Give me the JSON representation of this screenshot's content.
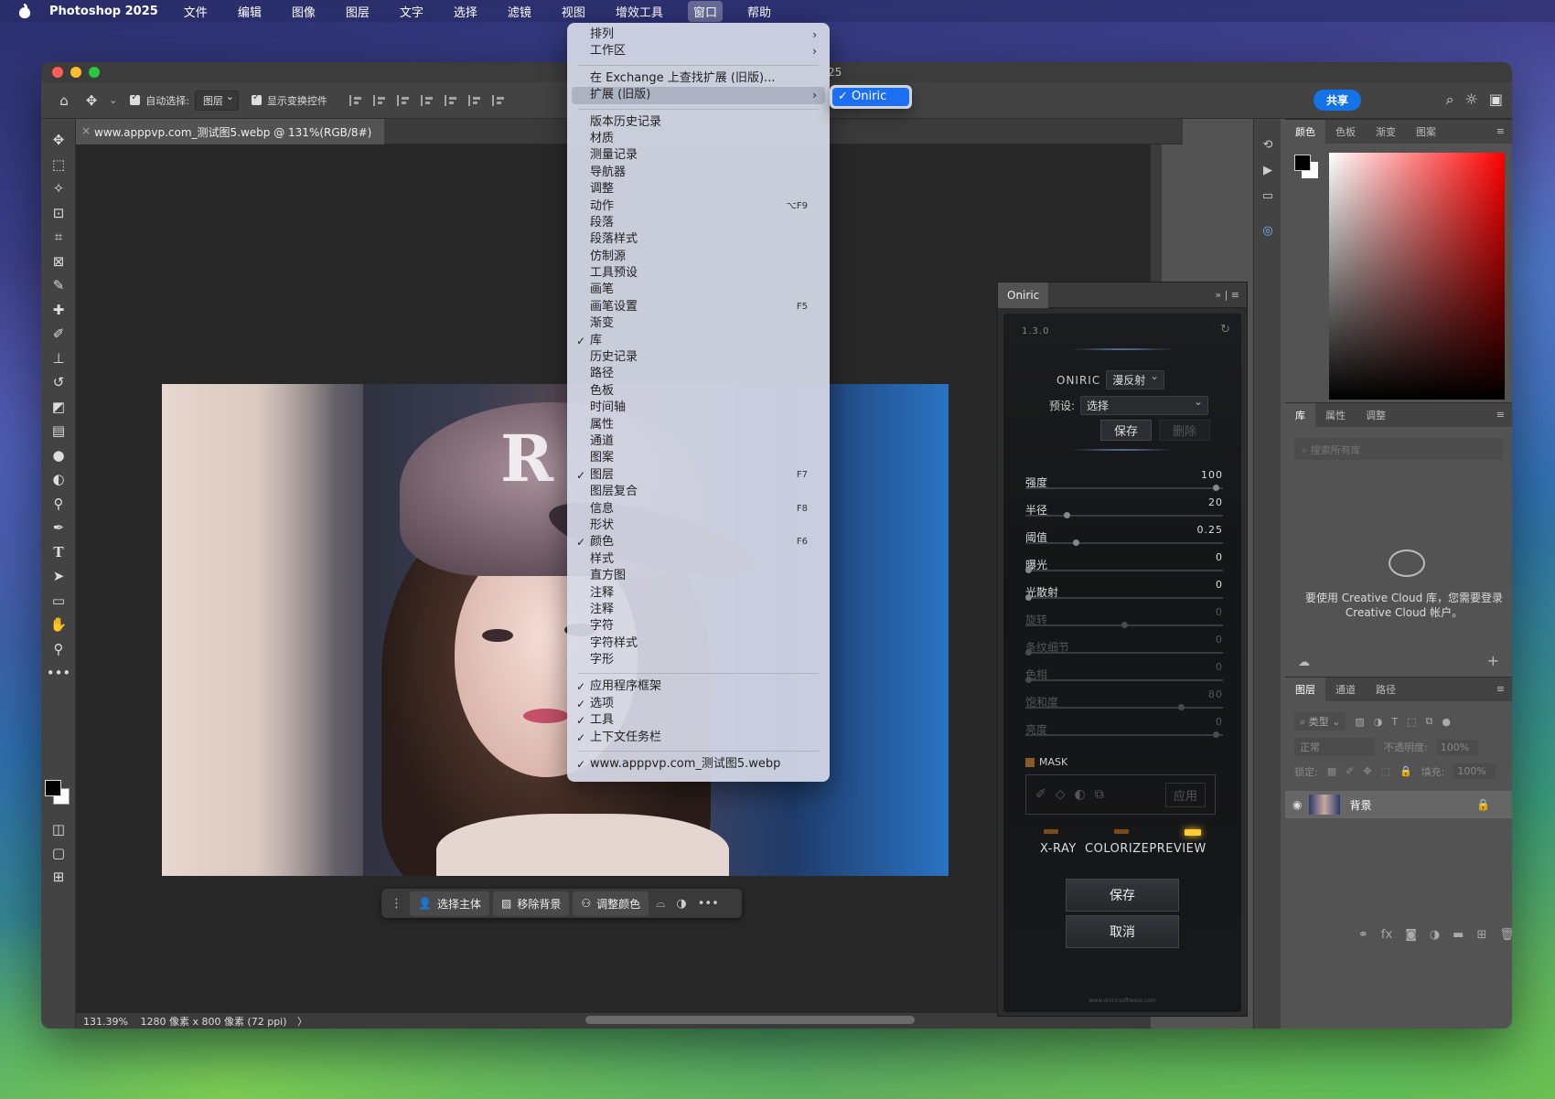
{
  "menubar": {
    "app_name": "Photoshop 2025",
    "items": [
      "文件",
      "编辑",
      "图像",
      "图层",
      "文字",
      "选择",
      "滤镜",
      "视图",
      "增效工具",
      "窗口",
      "帮助"
    ],
    "active_item": "窗口"
  },
  "window": {
    "title_fragment": "25"
  },
  "options_bar": {
    "auto_select_label": "自动选择:",
    "auto_select_value": "图层",
    "show_transform_label": "显示变换控件",
    "share_label": "共享"
  },
  "document": {
    "tab_label": "www.apppvp.com_测试图5.webp @ 131%(RGB/8#)",
    "status_zoom": "131.39%",
    "status_info": "1280 像素 x 800 像素 (72 ppi)",
    "status_arrow": "〉"
  },
  "context_bar": {
    "select_subject": "选择主体",
    "remove_bg": "移除背景",
    "adjust_color": "调整颜色"
  },
  "window_menu": {
    "items": [
      {
        "label": "排列",
        "submenu": true
      },
      {
        "label": "工作区",
        "submenu": true
      },
      {
        "sep": true
      },
      {
        "label": "在 Exchange 上查找扩展 (旧版)..."
      },
      {
        "label": "扩展 (旧版)",
        "submenu": true,
        "highlighted": true
      },
      {
        "sep": true
      },
      {
        "label": "版本历史记录"
      },
      {
        "label": "材质"
      },
      {
        "label": "测量记录"
      },
      {
        "label": "导航器"
      },
      {
        "label": "调整"
      },
      {
        "label": "动作",
        "shortcut": "⌥F9"
      },
      {
        "label": "段落"
      },
      {
        "label": "段落样式"
      },
      {
        "label": "仿制源"
      },
      {
        "label": "工具预设"
      },
      {
        "label": "画笔"
      },
      {
        "label": "画笔设置",
        "shortcut": "F5"
      },
      {
        "label": "渐变"
      },
      {
        "label": "库",
        "checked": true
      },
      {
        "label": "历史记录"
      },
      {
        "label": "路径"
      },
      {
        "label": "色板"
      },
      {
        "label": "时间轴"
      },
      {
        "label": "属性"
      },
      {
        "label": "通道"
      },
      {
        "label": "图案"
      },
      {
        "label": "图层",
        "checked": true,
        "shortcut": "F7"
      },
      {
        "label": "图层复合"
      },
      {
        "label": "信息",
        "shortcut": "F8"
      },
      {
        "label": "形状"
      },
      {
        "label": "颜色",
        "checked": true,
        "shortcut": "F6"
      },
      {
        "label": "样式"
      },
      {
        "label": "直方图"
      },
      {
        "label": "注释"
      },
      {
        "label": "注释"
      },
      {
        "label": "字符"
      },
      {
        "label": "字符样式"
      },
      {
        "label": "字形"
      },
      {
        "sep": true
      },
      {
        "label": "应用程序框架",
        "checked": true
      },
      {
        "label": "选项",
        "checked": true
      },
      {
        "label": "工具",
        "checked": true
      },
      {
        "label": "上下文任务栏",
        "checked": true
      },
      {
        "sep": true
      },
      {
        "label": "www.apppvp.com_测试图5.webp",
        "checked": true
      }
    ],
    "submenu_item": "✓ Oniric"
  },
  "oniric": {
    "tab_label": "Oniric",
    "version": "1.3.0",
    "mode_label": "ONIRIC",
    "mode_value": "漫反射",
    "preset_label": "预设:",
    "preset_value": "选择",
    "save_small": "保存",
    "delete_small": "删除",
    "sliders": [
      {
        "label": "强度",
        "value": "100",
        "pct": 0.98,
        "dim": false
      },
      {
        "label": "半径",
        "value": "20",
        "pct": 0.2,
        "dim": false
      },
      {
        "label": "阈值",
        "value": "0.25",
        "pct": 0.25,
        "dim": false
      },
      {
        "label": "曝光",
        "value": "0",
        "pct": 0.0,
        "dim": false
      },
      {
        "label": "光散射",
        "value": "0",
        "pct": 0.0,
        "dim": false
      },
      {
        "label": "旋转",
        "value": "0",
        "pct": 0.5,
        "dim": true
      },
      {
        "label": "条纹细节",
        "value": "0",
        "pct": 0.0,
        "dim": true
      },
      {
        "label": "色相",
        "value": "0",
        "pct": 0.0,
        "dim": true
      },
      {
        "label": "饱和度",
        "value": "80",
        "pct": 0.8,
        "dim": true
      },
      {
        "label": "亮度",
        "value": "0",
        "pct": 0.98,
        "dim": true
      }
    ],
    "mask_label": "MASK",
    "apply_label": "应用",
    "led_labels": "X-RAY  COLORIZEPREVIEW",
    "save_label": "保存",
    "cancel_label": "取消",
    "footer": "www.oniricsoftware.com"
  },
  "color_panel": {
    "tabs": [
      "颜色",
      "色板",
      "渐变",
      "图案"
    ]
  },
  "library_panel": {
    "tabs": [
      "库",
      "属性",
      "调整"
    ],
    "search_placeholder": "搜索所有库",
    "message": "要使用 Creative Cloud 库，您需要登录 Creative Cloud 帐户。"
  },
  "layers_panel": {
    "tabs": [
      "图层",
      "通道",
      "路径"
    ],
    "kind_label": "类型",
    "blend_mode": "正常",
    "opacity_label": "不透明度:",
    "opacity_value": "100%",
    "lock_label": "锁定:",
    "fill_label": "填充:",
    "fill_value": "100%",
    "layer_name": "背景"
  }
}
